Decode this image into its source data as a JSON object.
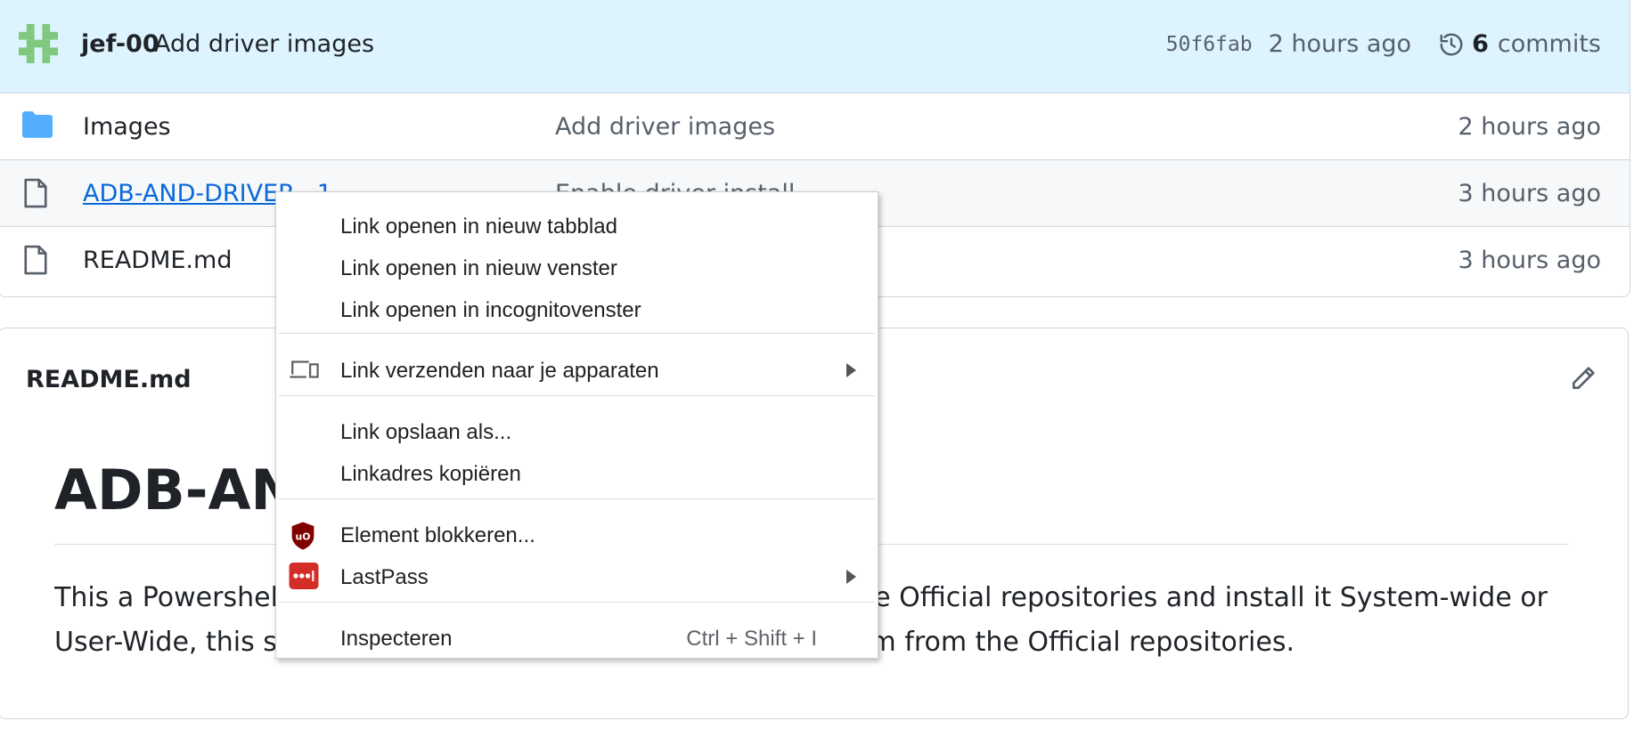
{
  "commit_bar": {
    "author": "jef-00",
    "message": "Add driver images",
    "sha": "50f6fab",
    "time": "2 hours ago",
    "commits_count": "6",
    "commits_label": "commits"
  },
  "files": [
    {
      "icon": "folder-icon",
      "name": "Images",
      "message": "Add driver images",
      "time": "2 hours ago"
    },
    {
      "icon": "file-icon",
      "name": "ADB-AND-DRIVER...1",
      "message": "Enable driver install...",
      "time": "3 hours ago"
    },
    {
      "icon": "file-icon",
      "name": "README.md",
      "message": "",
      "time": "3 hours ago"
    }
  ],
  "readme": {
    "title": "README.md",
    "heading": "ADB-AN",
    "paragraph_line1": "This a Powershell",
    "paragraph_line1_end": "ne Official repositories and install it System-wide or",
    "paragraph_line2": "User-Wide, this sc",
    "paragraph_line2_end": "om from the Official repositories."
  },
  "context_menu": {
    "items": [
      {
        "label": "Link openen in nieuw tabblad"
      },
      {
        "label": "Link openen in nieuw venster"
      },
      {
        "label": "Link openen in incognitovenster"
      },
      {
        "label": "Link verzenden naar je apparaten",
        "icon": "devices-icon",
        "submenu": true
      },
      {
        "label": "Link opslaan als..."
      },
      {
        "label": "Linkadres kopiëren"
      },
      {
        "label": "Element blokkeren...",
        "icon": "ublock-origin-icon"
      },
      {
        "label": "LastPass",
        "icon": "lastpass-icon",
        "submenu": true
      },
      {
        "label": "Inspecteren",
        "shortcut": "Ctrl + Shift + I"
      }
    ]
  },
  "colors": {
    "commit_bar_bg": "#ddf4ff",
    "link": "#0969da",
    "folder": "#54aeff",
    "ublock_red": "#800000",
    "lastpass_red": "#d32d27"
  }
}
